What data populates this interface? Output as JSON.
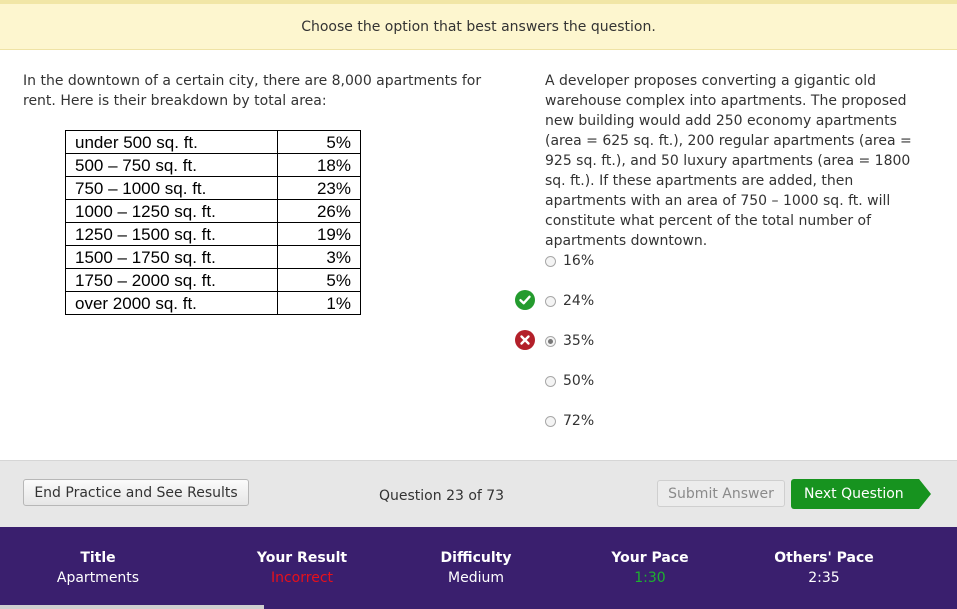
{
  "banner": {
    "instruction": "Choose the option that best answers the question."
  },
  "passage": {
    "text": "In the downtown of a certain city, there are 8,000 apartments for rent. Here is their breakdown by total area:",
    "table": [
      {
        "range": "under 500 sq. ft.",
        "percent": "5%"
      },
      {
        "range": "500 – 750 sq. ft.",
        "percent": "18%"
      },
      {
        "range": "750 – 1000 sq. ft.",
        "percent": "23%"
      },
      {
        "range": "1000 – 1250 sq. ft.",
        "percent": "26%"
      },
      {
        "range": "1250 – 1500 sq. ft.",
        "percent": "19%"
      },
      {
        "range": "1500 – 1750 sq. ft.",
        "percent": "3%"
      },
      {
        "range": "1750 – 2000 sq. ft.",
        "percent": "5%"
      },
      {
        "range": "over 2000 sq. ft.",
        "percent": "1%"
      }
    ]
  },
  "question": {
    "text": "A developer proposes converting a gigantic old warehouse complex into apartments. The proposed new building would add 250 economy apartments (area = 625 sq. ft.), 200 regular apartments (area = 925 sq. ft.), and 50 luxury apartments (area = 1800 sq. ft.). If these apartments are added, then apartments with an area of 750 – 1000 sq. ft. will constitute what percent of the total number of apartments downtown.",
    "choices": [
      {
        "label": "16%",
        "selected": false,
        "status": "none"
      },
      {
        "label": "24%",
        "selected": false,
        "status": "correct"
      },
      {
        "label": "35%",
        "selected": true,
        "status": "incorrect"
      },
      {
        "label": "50%",
        "selected": false,
        "status": "none"
      },
      {
        "label": "72%",
        "selected": false,
        "status": "none"
      }
    ]
  },
  "toolbar": {
    "end_label": "End Practice and See Results",
    "question_counter": "Question 23 of 73",
    "submit_label": "Submit Answer",
    "next_label": "Next Question"
  },
  "footer": {
    "title_label": "Title",
    "title_value": "Apartments",
    "result_label": "Your Result",
    "result_value": "Incorrect",
    "difficulty_label": "Difficulty",
    "difficulty_value": "Medium",
    "pace_label": "Your Pace",
    "pace_value": "1:30",
    "others_label": "Others' Pace",
    "others_value": "2:35"
  },
  "colors": {
    "banner_bg": "#fdf6cf",
    "footer_bg": "#3a1f6e",
    "next_button": "#17931f",
    "correct": "#249b2e",
    "incorrect": "#b3202a",
    "result_incorrect_text": "#e8101a",
    "pace_text": "#1db12e"
  },
  "icons": {
    "correct_mark": "check-circle-icon",
    "incorrect_mark": "x-circle-icon"
  }
}
